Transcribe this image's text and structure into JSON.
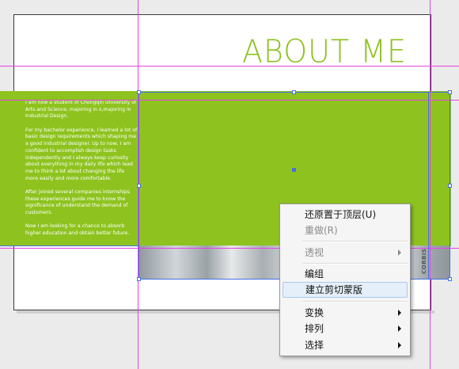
{
  "canvas": {
    "title": "ABOUT ME",
    "paragraphs": [
      "I am now a student of Chongqin University of Arts and Science, majoring in x,majoring in Industrial Design.",
      "For my bachelor experience, I learned a lot of basic design requirements which shaping me a good industrial designer. Up to now, I am confident to accomplish design tasks independently and I always keep curiosity about everything in my daily life which lead me to think a lot about changing the life more easily and more comfortable.",
      "After joined several companies internships these experiences guide me to know the significance of understand the demand of customers.",
      "Now I am looking for a chance to absorb higher education and obtain better future."
    ],
    "photo_credit": "CORBIS",
    "accent_color": "#8ec31f",
    "guide_color": "#e542e5",
    "selection_color": "#4a6fe0"
  },
  "context_menu": {
    "items": [
      {
        "label": "还原置于顶层(U)",
        "enabled": true,
        "submenu": false
      },
      {
        "label": "重做(R)",
        "enabled": false,
        "submenu": false
      },
      {
        "label": "透视",
        "enabled": false,
        "submenu": true
      },
      {
        "label": "编组",
        "enabled": true,
        "submenu": false
      },
      {
        "label": "建立剪切蒙版",
        "enabled": true,
        "submenu": false,
        "highlighted": true
      },
      {
        "label": "变换",
        "enabled": true,
        "submenu": true
      },
      {
        "label": "排列",
        "enabled": true,
        "submenu": true
      },
      {
        "label": "选择",
        "enabled": true,
        "submenu": true
      }
    ]
  }
}
